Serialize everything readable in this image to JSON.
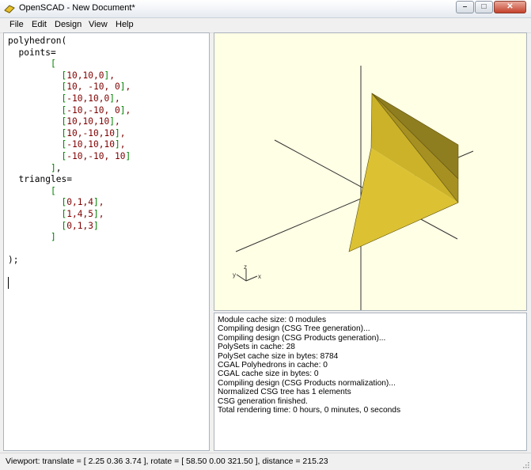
{
  "window": {
    "title": "OpenSCAD - New Document*"
  },
  "menu": {
    "items": [
      "File",
      "Edit",
      "Design",
      "View",
      "Help"
    ]
  },
  "editor": {
    "lines": [
      "polyhedron(",
      "  points=",
      "        [",
      "          [10,10,0],",
      "          [10, -10, 0],",
      "          [-10,10,0],",
      "          [-10,-10, 0],",
      "          [10,10,10],",
      "          [10,-10,10],",
      "          [-10,10,10],",
      "          [-10,-10, 10]",
      "        ],",
      "  triangles=",
      "        [",
      "          [0,1,4],",
      "          [1,4,5],",
      "          [0,1,3]",
      "        ]",
      "",
      ");"
    ]
  },
  "viewport": {
    "background": "#ffffe5",
    "face_colors": [
      "#8f7e1f",
      "#a69022",
      "#cbb229",
      "#dcc233"
    ],
    "axis_labels": {
      "x": "x",
      "y": "y",
      "z": "z"
    }
  },
  "console": {
    "lines": [
      "Module cache size: 0 modules",
      "Compiling design (CSG Tree generation)...",
      "Compiling design (CSG Products generation)...",
      "PolySets in cache: 28",
      "PolySet cache size in bytes: 8784",
      "CGAL Polyhedrons in cache: 0",
      "CGAL cache size in bytes: 0",
      "Compiling design (CSG Products normalization)...",
      "Normalized CSG tree has 1 elements",
      "CSG generation finished.",
      "Total rendering time: 0 hours, 0 minutes, 0 seconds"
    ]
  },
  "status": {
    "text": "Viewport: translate = [ 2.25 0.36 3.74 ], rotate = [ 58.50 0.00 321.50 ], distance = 215.23"
  }
}
